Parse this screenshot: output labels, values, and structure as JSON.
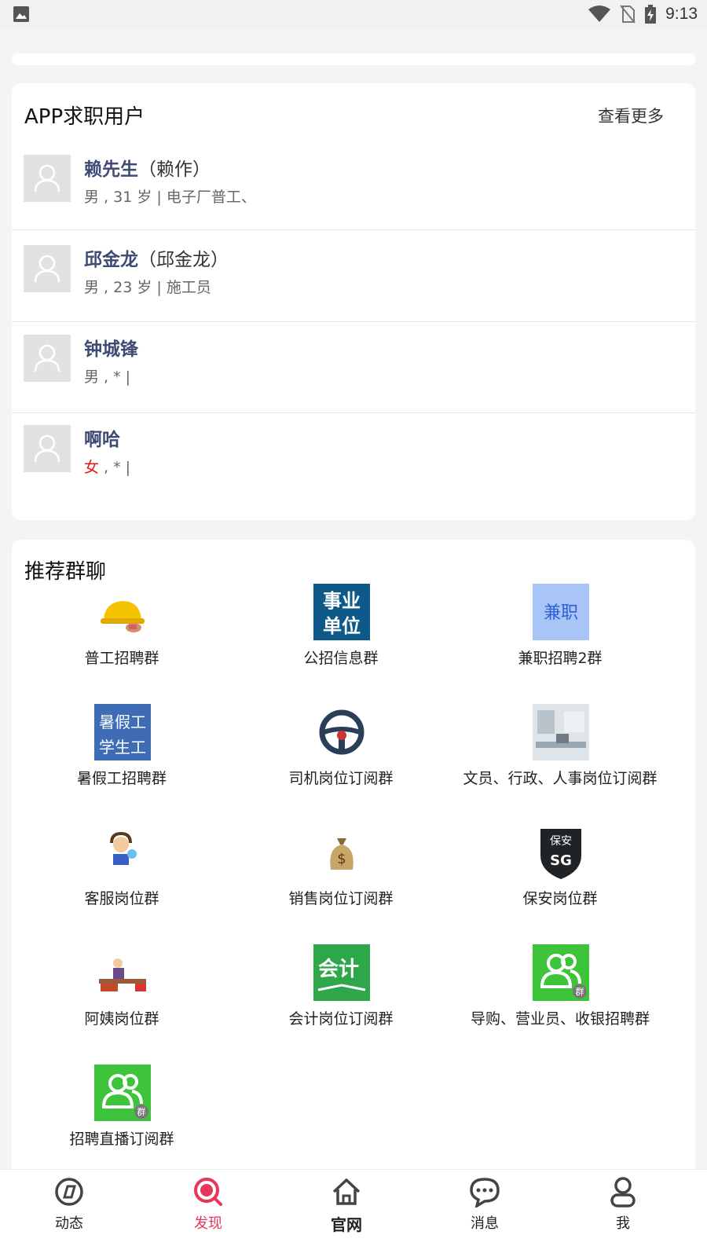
{
  "status_bar": {
    "time": "9:13"
  },
  "users_section": {
    "title": "APP求职用户",
    "more": "查看更多",
    "users": [
      {
        "name": "赖先生",
        "alias": "（赖作）",
        "gender": "男",
        "detail": " , 31 岁 | 电子厂普工、"
      },
      {
        "name": "邱金龙",
        "alias": "（邱金龙）",
        "gender": "男",
        "detail": " , 23 岁 | 施工员"
      },
      {
        "name": "钟城锋",
        "alias": "",
        "gender": "男",
        "detail": " , * |"
      },
      {
        "name": "啊哈",
        "alias": "",
        "gender": "女",
        "detail": " , * |"
      }
    ]
  },
  "groups_section": {
    "title": "推荐群聊",
    "groups": [
      {
        "label": "普工招聘群",
        "icon": "hardhat-icon"
      },
      {
        "label": "公招信息群",
        "icon": "public-unit-icon",
        "icon_text": [
          "事业",
          "单位"
        ]
      },
      {
        "label": "兼职招聘2群",
        "icon": "parttime-icon",
        "icon_text": [
          "兼职"
        ]
      },
      {
        "label": "暑假工招聘群",
        "icon": "summer-worker-icon",
        "icon_text": [
          "暑假工",
          "学生工"
        ]
      },
      {
        "label": "司机岗位订阅群",
        "icon": "steering-wheel-icon"
      },
      {
        "label": "文员、行政、人事岗位订阅群",
        "icon": "office-icon"
      },
      {
        "label": "客服岗位群",
        "icon": "customer-service-icon"
      },
      {
        "label": "销售岗位订阅群",
        "icon": "money-bag-icon"
      },
      {
        "label": "保安岗位群",
        "icon": "security-badge-icon",
        "icon_text": [
          "保安"
        ]
      },
      {
        "label": "阿姨岗位群",
        "icon": "housekeeper-icon"
      },
      {
        "label": "会计岗位订阅群",
        "icon": "accounting-icon",
        "icon_text": [
          "会计"
        ]
      },
      {
        "label": "导购、营业员、收银招聘群",
        "icon": "group-chat-icon",
        "icon_text": [
          "群"
        ]
      },
      {
        "label": "招聘直播订阅群",
        "icon": "group-chat-icon",
        "icon_text": [
          "群"
        ]
      }
    ]
  },
  "bottom_nav": {
    "items": [
      {
        "label": "动态",
        "icon": "compass-icon"
      },
      {
        "label": "发现",
        "icon": "discover-search-icon",
        "active": true
      },
      {
        "label": "官网",
        "icon": "home-icon"
      },
      {
        "label": "消息",
        "icon": "chat-bubble-icon"
      },
      {
        "label": "我",
        "icon": "person-icon"
      }
    ]
  },
  "colors": {
    "accent": "#e63659",
    "name_blue": "#3f4b74",
    "female": "#e11111"
  }
}
